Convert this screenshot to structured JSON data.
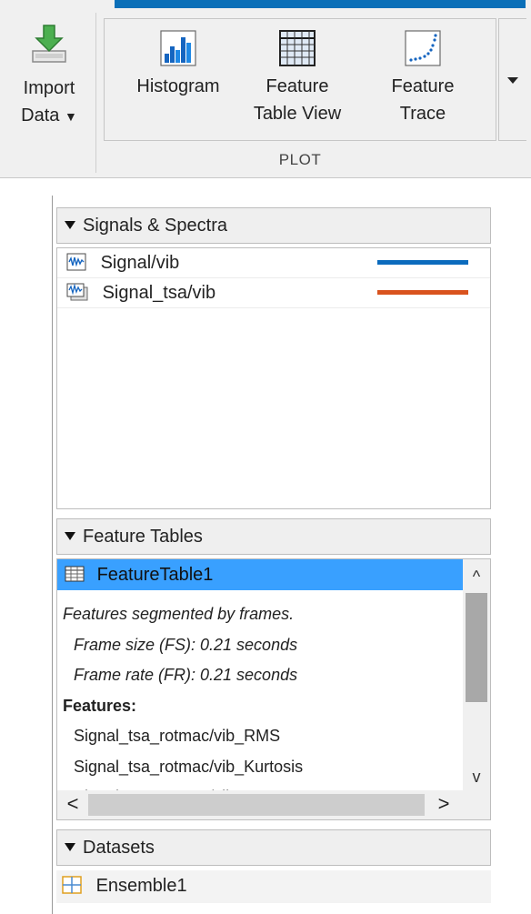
{
  "toolstrip": {
    "import": {
      "label_line1": "Import",
      "label_line2": "Data",
      "icon": "import-data-icon"
    },
    "plot_group": {
      "label": "PLOT",
      "buttons": [
        {
          "line1": "Histogram",
          "line2": "",
          "icon": "histogram-icon"
        },
        {
          "line1": "Feature",
          "line2": "Table View",
          "icon": "table-view-icon"
        },
        {
          "line1": "Feature",
          "line2": "Trace",
          "icon": "feature-trace-icon"
        }
      ]
    },
    "accent_color": "#0a6fb8"
  },
  "signals_panel": {
    "title": "Signals & Spectra",
    "items": [
      {
        "label": "Signal/vib",
        "color": "#0b6bbd",
        "icon": "signal-icon"
      },
      {
        "label": "Signal_tsa/vib",
        "color": "#d9531e",
        "icon": "signal-stack-icon"
      }
    ]
  },
  "feature_tables_panel": {
    "title": "Feature Tables",
    "selected": "FeatureTable1",
    "description": {
      "line1": "Features segmented by frames.",
      "line2": "Frame size (FS): 0.21 seconds",
      "line3": "Frame rate (FR): 0.21 seconds",
      "features_heading": "Features:",
      "features": [
        "Signal_tsa_rotmac/vib_RMS",
        "Signal_tsa_rotmac/vib_Kurtosis",
        "Signal_tsa_rotmac/vib_CrestFactor"
      ]
    }
  },
  "datasets_panel": {
    "title": "Datasets",
    "items": [
      {
        "label": "Ensemble1",
        "icon": "ensemble-icon"
      }
    ]
  }
}
